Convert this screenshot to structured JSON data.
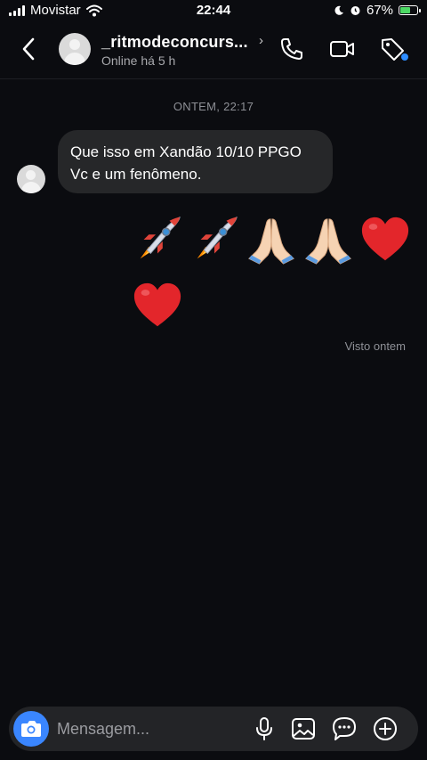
{
  "status_bar": {
    "carrier": "Movistar",
    "time": "22:44",
    "battery_percent": "67%",
    "battery_level": 0.67,
    "battery_color": "#4cd964"
  },
  "header": {
    "username": "_ritmodeconcurs...",
    "chevron": "›",
    "status": "Online há 5 h",
    "icons": [
      "back-arrow-icon",
      "phone-icon",
      "video-camera-icon",
      "tag-icon"
    ],
    "notification_dot_color": "#2d8cff"
  },
  "conversation": {
    "date_label": "ONTEM, 22:17",
    "received_message": {
      "line1": "Que isso em Xandão 10/10 PPGO",
      "line2": "Vc e um fenômeno."
    },
    "sent_emojis": [
      "🚀",
      "🚀",
      "🙏",
      "🙏",
      "❤️",
      "❤️"
    ],
    "seen_label": "Visto ontem"
  },
  "composer": {
    "placeholder": "Mensagem...",
    "value": "",
    "icons": [
      "camera-icon",
      "microphone-icon",
      "gallery-icon",
      "sticker-icon",
      "add-icon"
    ],
    "accent_color": "#3a86ff"
  }
}
